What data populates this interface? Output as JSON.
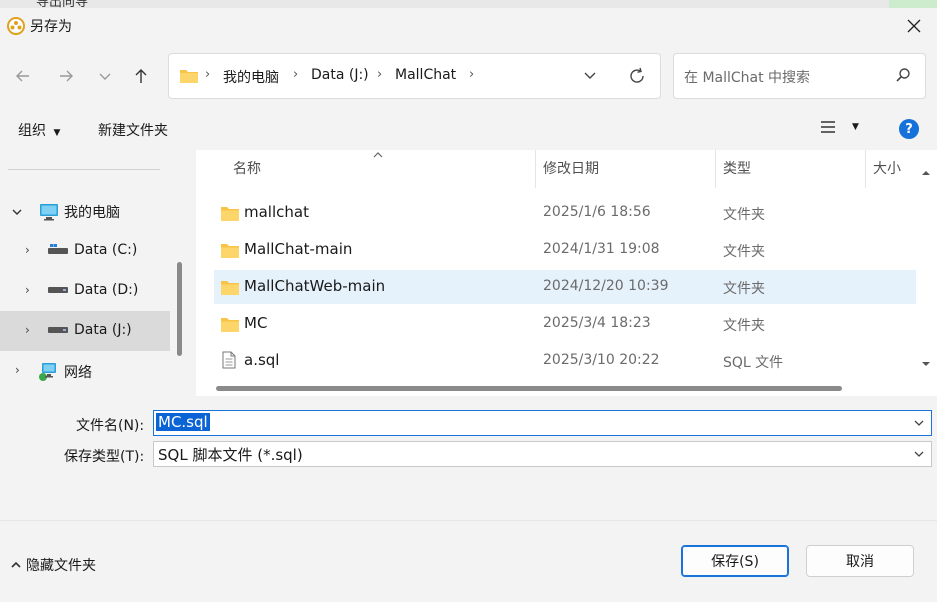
{
  "background_window": {
    "title": "导出向导"
  },
  "dialog": {
    "title": "另存为"
  },
  "address": {
    "crumbs": [
      "我的电脑",
      "Data (J:)",
      "MallChat"
    ]
  },
  "search": {
    "placeholder": "在 MallChat 中搜索"
  },
  "toolbar": {
    "organize": "组织",
    "new_folder": "新建文件夹",
    "help": "?"
  },
  "nav": {
    "items": [
      {
        "label": "我的电脑",
        "icon": "computer-icon",
        "expanded": true
      },
      {
        "label": "Data (C:)",
        "icon": "drive-icon"
      },
      {
        "label": "Data (D:)",
        "icon": "drive-icon"
      },
      {
        "label": "Data (J:)",
        "icon": "drive-icon",
        "selected": true
      },
      {
        "label": "网络",
        "icon": "network-icon"
      }
    ]
  },
  "columns": {
    "name": "名称",
    "modified": "修改日期",
    "type": "类型",
    "size": "大小"
  },
  "files": [
    {
      "name": "mallchat",
      "modified": "2025/1/6 18:56",
      "type": "文件夹",
      "icon": "folder-icon"
    },
    {
      "name": "MallChat-main",
      "modified": "2024/1/31 19:08",
      "type": "文件夹",
      "icon": "folder-icon"
    },
    {
      "name": "MallChatWeb-main",
      "modified": "2024/12/20 10:39",
      "type": "文件夹",
      "icon": "folder-icon",
      "selected": true
    },
    {
      "name": "MC",
      "modified": "2025/3/4 18:23",
      "type": "文件夹",
      "icon": "folder-icon"
    },
    {
      "name": "a.sql",
      "modified": "2025/3/10 20:22",
      "type": "SQL 文件",
      "icon": "file-icon"
    }
  ],
  "form": {
    "filename_label": "文件名(N):",
    "filename_value": "MC.sql",
    "filetype_label": "保存类型(T):",
    "filetype_value": "SQL 脚本文件 (*.sql)"
  },
  "footer": {
    "hide_folders": "隐藏文件夹",
    "save": "保存(S)",
    "cancel": "取消"
  },
  "colors": {
    "accent": "#1a73d9",
    "selection": "#e5f1fb",
    "folder": "#f8c346"
  }
}
